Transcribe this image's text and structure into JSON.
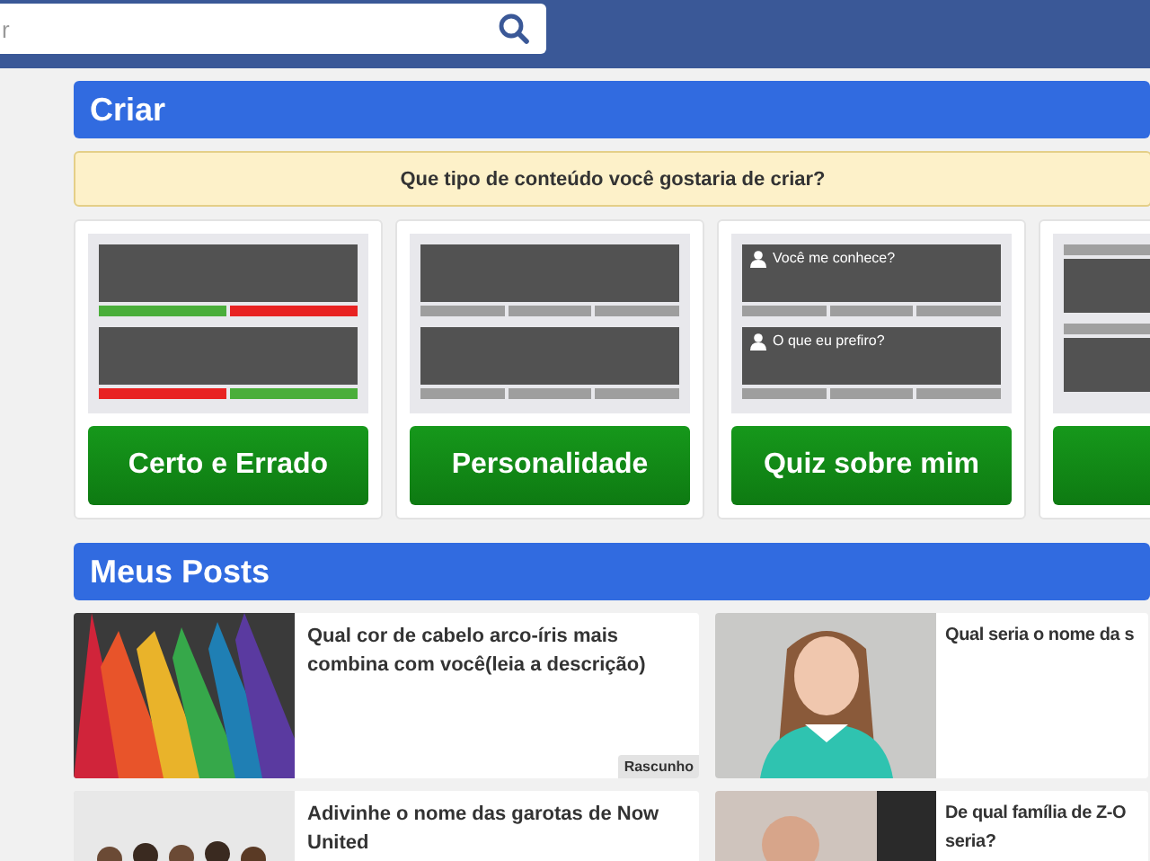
{
  "search": {
    "placeholder": "r"
  },
  "create": {
    "title": "Criar",
    "notice": "Que tipo de conteúdo você gostaria de criar?",
    "types": [
      {
        "kind": "right-wrong",
        "label": "Certo e Errado"
      },
      {
        "kind": "personality",
        "label": "Personalidade"
      },
      {
        "kind": "about-me",
        "label": "Quiz sobre mim",
        "questions": [
          "Você me conhece?",
          "O que eu prefiro?"
        ]
      },
      {
        "kind": "poll"
      }
    ]
  },
  "posts": {
    "title": "Meus Posts",
    "items": [
      {
        "title": "Qual cor de cabelo arco-íris mais combina com você(leia a descrição)",
        "badge": "Rascunho"
      },
      {
        "title": "Qual seria o nome da s"
      },
      {
        "title": "Adivinhe o nome das garotas de Now United"
      },
      {
        "title": "De qual família de Z-O seria?"
      }
    ]
  }
}
